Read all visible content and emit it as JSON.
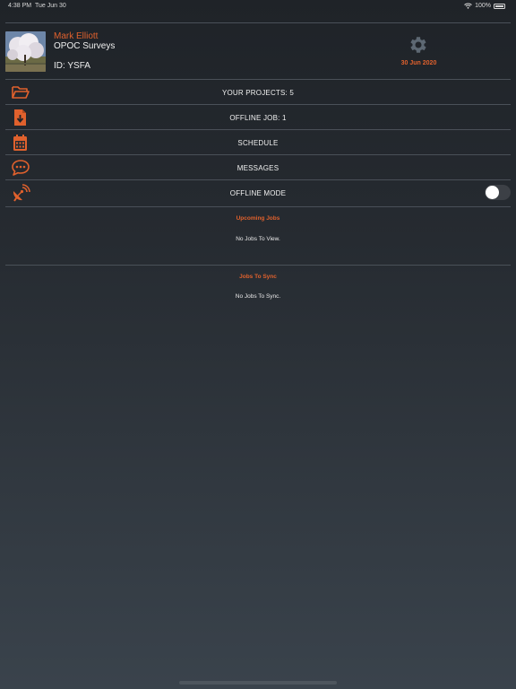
{
  "status_bar": {
    "time": "4:38 PM",
    "date": "Tue Jun 30",
    "battery": "100%"
  },
  "profile": {
    "name": "Mark Elliott",
    "company": "OPOC Surveys",
    "id": "ID: YSFA",
    "date": "30 Jun 2020"
  },
  "menu": {
    "projects": "YOUR PROJECTS: 5",
    "offline_job": "OFFLINE JOB: 1",
    "schedule": "SCHEDULE",
    "messages": "MESSAGES",
    "offline_mode": "OFFLINE MODE"
  },
  "offline_mode_on": false,
  "sections": {
    "upcoming_title": "Upcoming Jobs",
    "upcoming_empty": "No Jobs To View.",
    "sync_title": "Jobs To Sync",
    "sync_empty": "No Jobs To Sync."
  },
  "colors": {
    "accent": "#e0612d",
    "text": "#f0f0f0",
    "gear": "#5d6873"
  },
  "icons": [
    "folder-open-icon",
    "file-download-icon",
    "calendar-icon",
    "chat-icon",
    "satellite-dish-icon",
    "gear-icon",
    "wifi-icon",
    "battery-icon"
  ]
}
